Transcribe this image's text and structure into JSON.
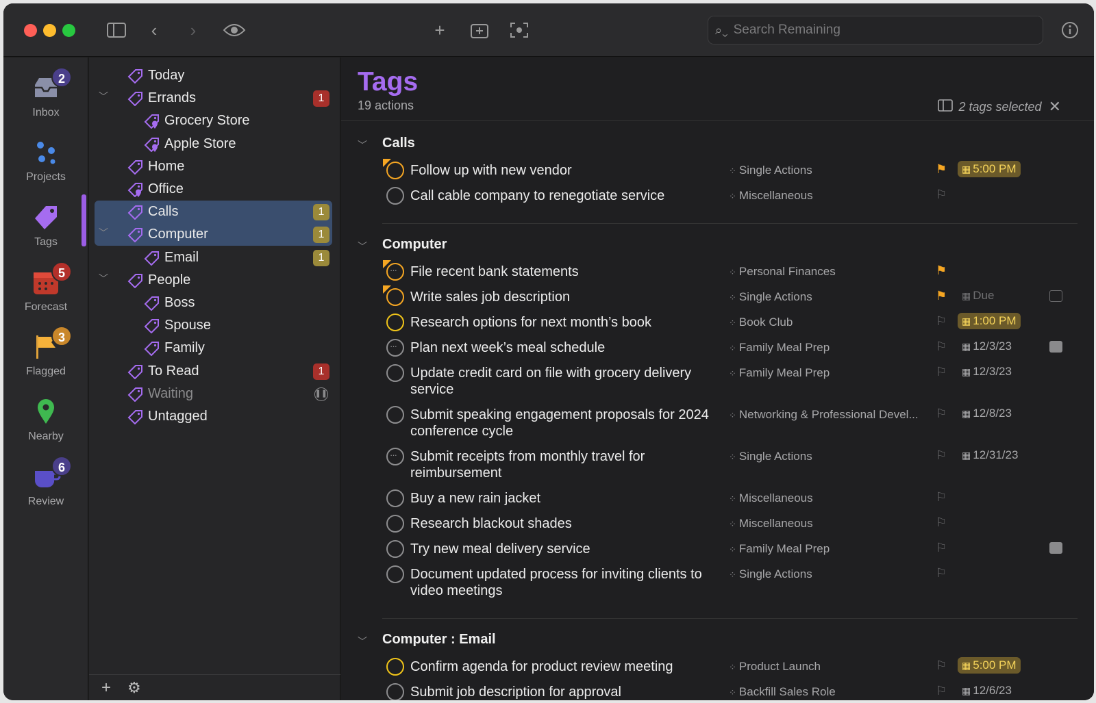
{
  "toolbar": {
    "search_placeholder": "Search Remaining"
  },
  "perspectives": [
    {
      "label": "Inbox",
      "badge": "2",
      "badge_color": "#4a3f8a"
    },
    {
      "label": "Projects",
      "badge": ""
    },
    {
      "label": "Tags",
      "badge": ""
    },
    {
      "label": "Forecast",
      "badge": "5",
      "badge_color": "#b3302a"
    },
    {
      "label": "Flagged",
      "badge": "3",
      "badge_color": "#c9872a"
    },
    {
      "label": "Nearby",
      "badge": ""
    },
    {
      "label": "Review",
      "badge": "6",
      "badge_color": "#4a3f8a"
    }
  ],
  "sidebar": {
    "items": [
      {
        "label": "Today",
        "indent": 0,
        "chev": false,
        "count": "",
        "count_color": ""
      },
      {
        "label": "Errands",
        "indent": 0,
        "chev": true,
        "count": "1",
        "count_color": "#a8302b"
      },
      {
        "label": "Grocery Store",
        "indent": 1,
        "chev": false,
        "count": "",
        "count_color": "",
        "location": true
      },
      {
        "label": "Apple Store",
        "indent": 1,
        "chev": false,
        "count": "",
        "count_color": "",
        "location": true
      },
      {
        "label": "Home",
        "indent": 0,
        "chev": false,
        "count": "",
        "count_color": ""
      },
      {
        "label": "Office",
        "indent": 0,
        "chev": false,
        "count": "",
        "count_color": "",
        "location": true
      },
      {
        "label": "Calls",
        "indent": 0,
        "chev": false,
        "count": "1",
        "count_color": "#9b8a3a",
        "selected": true
      },
      {
        "label": "Computer",
        "indent": 0,
        "chev": true,
        "count": "1",
        "count_color": "#9b8a3a",
        "selected": true
      },
      {
        "label": "Email",
        "indent": 1,
        "chev": false,
        "count": "1",
        "count_color": "#9b8a3a"
      },
      {
        "label": "People",
        "indent": 0,
        "chev": true,
        "count": "",
        "count_color": ""
      },
      {
        "label": "Boss",
        "indent": 1,
        "chev": false,
        "count": "",
        "count_color": ""
      },
      {
        "label": "Spouse",
        "indent": 1,
        "chev": false,
        "count": "",
        "count_color": ""
      },
      {
        "label": "Family",
        "indent": 1,
        "chev": false,
        "count": "",
        "count_color": ""
      },
      {
        "label": "To Read",
        "indent": 0,
        "chev": false,
        "count": "1",
        "count_color": "#a8302b"
      },
      {
        "label": "Waiting",
        "indent": 0,
        "chev": false,
        "count": "",
        "count_color": "",
        "paused": true
      },
      {
        "label": "Untagged",
        "indent": 0,
        "chev": false,
        "count": "",
        "count_color": ""
      }
    ]
  },
  "main": {
    "title": "Tags",
    "subtitle": "19 actions",
    "selection_text": "2 tags selected",
    "groups": [
      {
        "name": "Calls",
        "tasks": [
          {
            "title": "Follow up with new vendor",
            "project": "Single Actions",
            "flagged": true,
            "date": "5:00 PM",
            "date_hl": true,
            "due": true,
            "dots": false,
            "note": false
          },
          {
            "title": "Call cable company to renegotiate service",
            "project": "Miscellaneous",
            "flagged": false,
            "date": "",
            "date_hl": false,
            "due": false,
            "dots": false,
            "note": false
          }
        ]
      },
      {
        "name": "Computer",
        "tasks": [
          {
            "title": "File recent bank statements",
            "project": "Personal Finances",
            "flagged": true,
            "date": "",
            "date_hl": false,
            "due": false,
            "dots": true,
            "note": false
          },
          {
            "title": "Write sales job description",
            "project": "Single Actions",
            "flagged": true,
            "date": "Due",
            "date_hl": false,
            "due": false,
            "dots": false,
            "note": true,
            "dim": true
          },
          {
            "title": "Research options for next month’s book",
            "project": "Book Club",
            "flagged": false,
            "date": "1:00 PM",
            "date_hl": true,
            "due": true,
            "dots": false,
            "note": false
          },
          {
            "title": "Plan next week’s meal schedule",
            "project": "Family Meal Prep",
            "flagged": false,
            "date": "12/3/23",
            "date_hl": false,
            "due": false,
            "dots": true,
            "note": true
          },
          {
            "title": "Update credit card on file with grocery delivery service",
            "project": "Family Meal Prep",
            "flagged": false,
            "date": "12/3/23",
            "date_hl": false,
            "due": false,
            "dots": false,
            "note": false
          },
          {
            "title": "Submit speaking engagement proposals for 2024 conference cycle",
            "project": "Networking & Professional Devel...",
            "flagged": false,
            "date": "12/8/23",
            "date_hl": false,
            "due": false,
            "dots": false,
            "note": false
          },
          {
            "title": "Submit receipts from monthly travel for reimbursement",
            "project": "Single Actions",
            "flagged": false,
            "date": "12/31/23",
            "date_hl": false,
            "due": false,
            "dots": true,
            "note": false
          },
          {
            "title": "Buy a new rain jacket",
            "project": "Miscellaneous",
            "flagged": false,
            "date": "",
            "date_hl": false,
            "due": false,
            "dots": false,
            "note": false
          },
          {
            "title": "Research blackout shades",
            "project": "Miscellaneous",
            "flagged": false,
            "date": "",
            "date_hl": false,
            "due": false,
            "dots": false,
            "note": false
          },
          {
            "title": "Try new meal delivery service",
            "project": "Family Meal Prep",
            "flagged": false,
            "date": "",
            "date_hl": false,
            "due": false,
            "dots": false,
            "note": true
          },
          {
            "title": "Document updated process for inviting clients to video meetings",
            "project": "Single Actions",
            "flagged": false,
            "date": "",
            "date_hl": false,
            "due": false,
            "dots": false,
            "note": false
          }
        ]
      },
      {
        "name": "Computer : Email",
        "tasks": [
          {
            "title": "Confirm agenda for product review meeting",
            "project": "Product Launch",
            "flagged": false,
            "date": "5:00 PM",
            "date_hl": true,
            "due": true,
            "dots": false,
            "note": false
          },
          {
            "title": "Submit job description for approval",
            "project": "Backfill Sales Role",
            "flagged": false,
            "date": "12/6/23",
            "date_hl": false,
            "due": false,
            "dots": false,
            "note": false
          }
        ]
      }
    ]
  }
}
